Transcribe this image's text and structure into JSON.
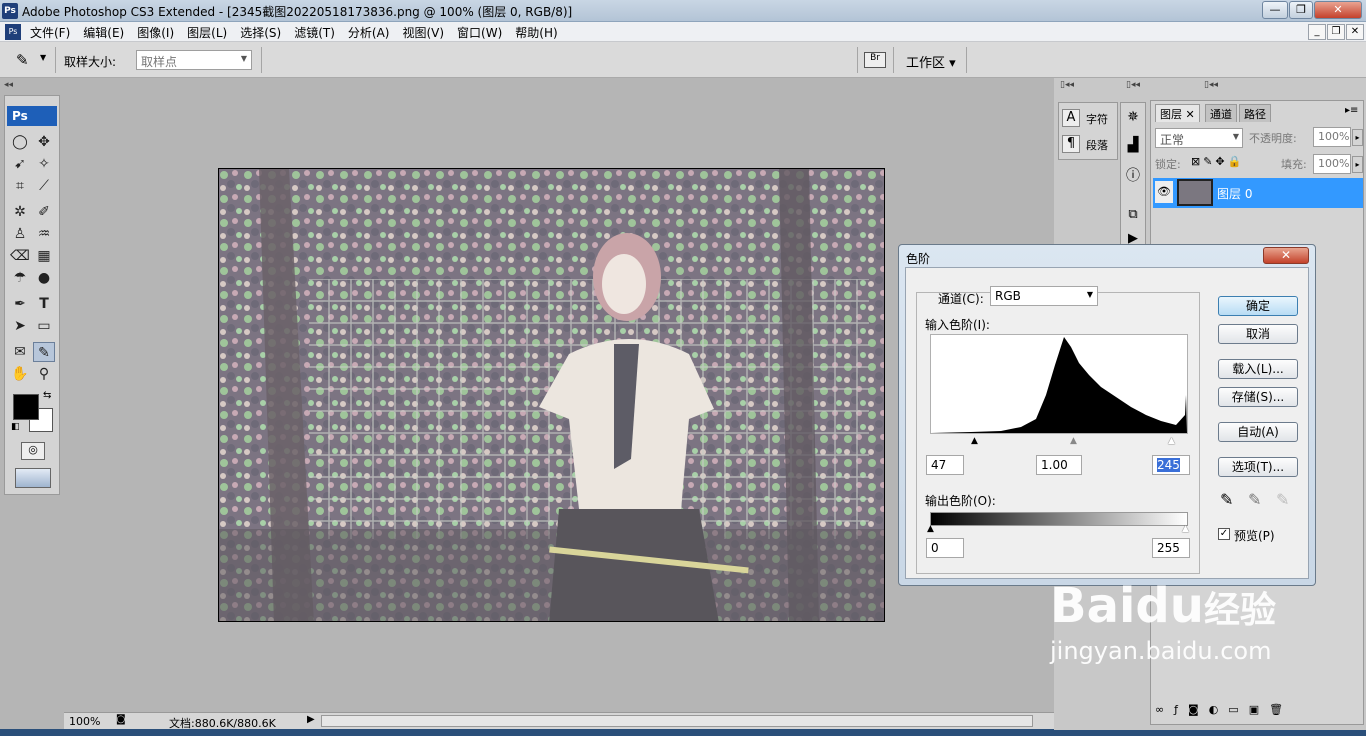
{
  "window": {
    "title": "Adobe Photoshop CS3 Extended - [2345截图20220518173836.png @ 100% (图层 0, RGB/8)]",
    "app_icon": "Ps"
  },
  "menu": [
    "文件(F)",
    "编辑(E)",
    "图像(I)",
    "图层(L)",
    "选择(S)",
    "滤镜(T)",
    "分析(A)",
    "视图(V)",
    "窗口(W)",
    "帮助(H)"
  ],
  "options": {
    "sample_size_label": "取样大小:",
    "sample_size_value": "取样点",
    "workspace_label": "工作区"
  },
  "toolbox": {
    "header": "Ps"
  },
  "right_panels": {
    "char_label": "字符",
    "para_label": "段落",
    "tabs": [
      "图层",
      "通道",
      "路径"
    ],
    "blend_mode": "正常",
    "opacity_label": "不透明度:",
    "opacity_value": "100%",
    "lock_label": "锁定:",
    "fill_label": "填充:",
    "fill_value": "100%",
    "layer_name": "图层 0"
  },
  "status": {
    "zoom": "100%",
    "doc": "文档:880.6K/880.6K"
  },
  "dialog": {
    "title": "色阶",
    "channel_label": "通道(C):",
    "channel_value": "RGB",
    "input_label": "输入色阶(I):",
    "input_black": "47",
    "input_gamma": "1.00",
    "input_white": "245",
    "output_label": "输出色阶(O):",
    "output_black": "0",
    "output_white": "255",
    "buttons": {
      "ok": "确定",
      "cancel": "取消",
      "load": "载入(L)...",
      "save": "存储(S)...",
      "auto": "自动(A)",
      "options": "选项(T)..."
    },
    "preview_label": "预览(P)",
    "preview_checked": true
  },
  "watermark": {
    "brand": "Baidu",
    "brand_cn": "经验",
    "url": "jingyan.baidu.com"
  }
}
